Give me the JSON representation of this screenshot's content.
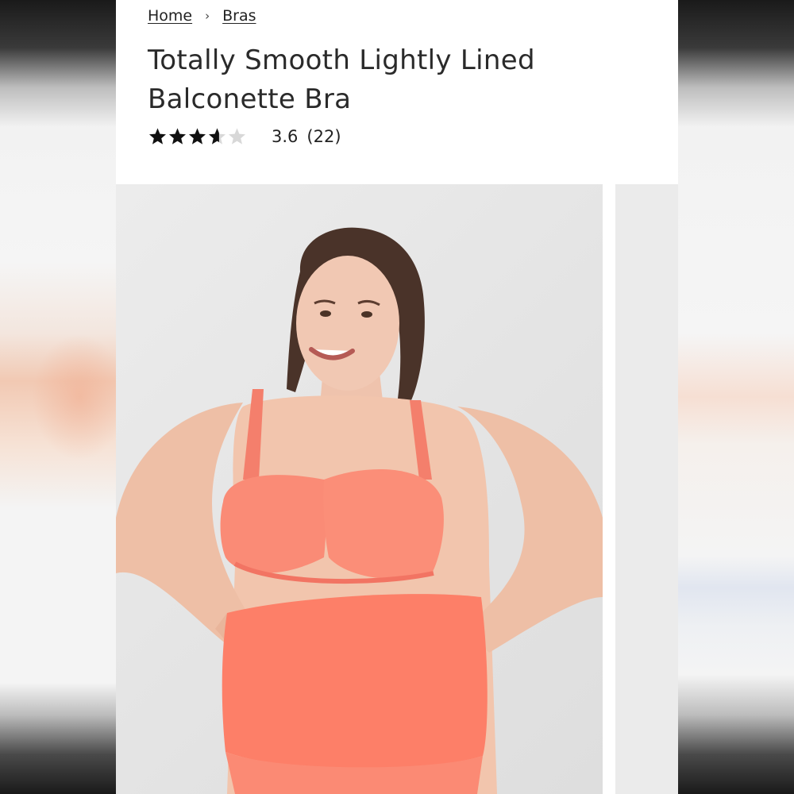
{
  "breadcrumb": {
    "home": "Home",
    "separator": "›",
    "current": "Bras"
  },
  "product": {
    "title": "Totally Smooth Lightly Lined Balconette Bra"
  },
  "rating": {
    "value": 3.6,
    "max": 5,
    "score_text": "3.6",
    "count_text": "(22)",
    "star_color": "#111111",
    "empty_star_color": "#d8d8d8"
  },
  "gallery": {
    "main_image_icon": "product-photo-icon",
    "next_image_icon": "product-photo-icon"
  }
}
